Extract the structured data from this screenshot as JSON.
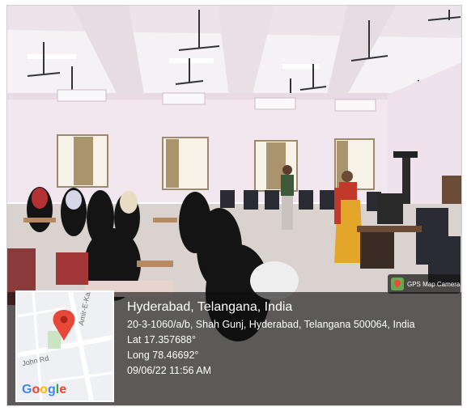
{
  "photo": {
    "subject": "classroom-seminar-hall",
    "colors": {
      "walls": "#f2e6ef",
      "ceiling": "#f6f1f5",
      "floor": "#d9d2cf",
      "saree": "#e3a62b",
      "hijab": "#141414"
    }
  },
  "badge": {
    "label": "GPS Map Camera",
    "icon": "gps-map-camera-icon"
  },
  "map": {
    "roads": [
      "John Rd",
      "Amir-E-Kabir St"
    ],
    "pin_icon": "location-pin-icon",
    "pin_color": "#e8483a",
    "brand_letters": [
      "G",
      "o",
      "o",
      "g",
      "l",
      "e"
    ]
  },
  "location": {
    "title": "Hyderabad, Telangana, India",
    "address": "20-3-1060/a/b, Shah Gunj, Hyderabad, Telangana 500064, India",
    "lat": "Lat 17.357688°",
    "long": "Long 78.46692°",
    "datetime": "09/06/22 11:56 AM"
  }
}
